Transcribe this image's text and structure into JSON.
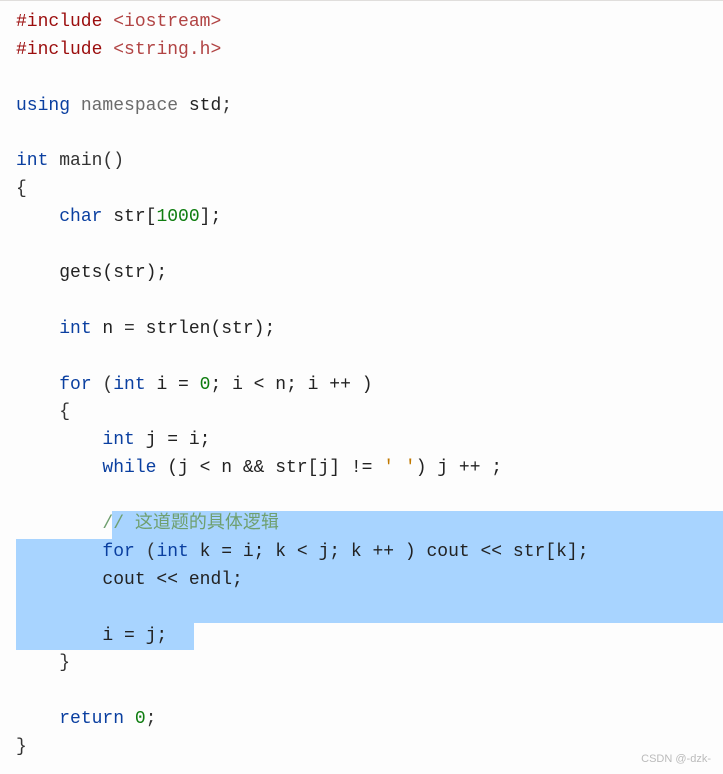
{
  "code": {
    "lines": [
      {
        "type": "include",
        "directive": "#include",
        "path": "<iostream>"
      },
      {
        "type": "include",
        "directive": "#include",
        "path": "<string.h>"
      },
      {
        "type": "blank"
      },
      {
        "type": "using",
        "kw1": "using",
        "ns": "namespace",
        "ident": "std",
        "semi": ";"
      },
      {
        "type": "blank"
      },
      {
        "type": "func-decl",
        "ret": "int",
        "name": "main",
        "parens": "()"
      },
      {
        "type": "brace-open",
        "text": "{"
      },
      {
        "type": "decl",
        "indent": 1,
        "kw": "char",
        "rest": " str[",
        "num": "1000",
        "rest2": "];"
      },
      {
        "type": "blank"
      },
      {
        "type": "call",
        "indent": 1,
        "text": "gets(str);"
      },
      {
        "type": "blank"
      },
      {
        "type": "decl2",
        "indent": 1,
        "kw": "int",
        "ident": " n ",
        "op": "=",
        "rest": " strlen(str);"
      },
      {
        "type": "blank"
      },
      {
        "type": "for1",
        "indent": 1,
        "kw": "for",
        "p1": " (",
        "kw2": "int",
        "rest": " i = ",
        "num": "0",
        "rest2": "; i < n; i ++ )"
      },
      {
        "type": "brace-open-i1",
        "indent": 1,
        "text": "{"
      },
      {
        "type": "decl3",
        "indent": 2,
        "kw": "int",
        "rest": " j = i;"
      },
      {
        "type": "while1",
        "indent": 2,
        "kw": "while",
        "rest": " (j < n && str[j] != ",
        "str": "' '",
        "rest2": ") j ++ ;"
      },
      {
        "type": "blank"
      },
      {
        "type": "comment",
        "indent": 2,
        "text": "// 这道题的具体逻辑",
        "highlighted": true
      },
      {
        "type": "for2",
        "indent": 2,
        "kw": "for",
        "p1": " (",
        "kw2": "int",
        "rest": " k = i; k < j; k ++ ) cout << str[k];",
        "highlighted": true
      },
      {
        "type": "stmt",
        "indent": 2,
        "text": "cout << endl;",
        "highlighted": true
      },
      {
        "type": "blank",
        "highlighted": true
      },
      {
        "type": "stmt",
        "indent": 2,
        "text": "i = j;",
        "highlighted": "partial"
      },
      {
        "type": "brace-close-i1",
        "indent": 1,
        "text": "}"
      },
      {
        "type": "blank"
      },
      {
        "type": "return",
        "indent": 1,
        "kw": "return",
        "sp": " ",
        "num": "0",
        "semi": ";"
      },
      {
        "type": "brace-close",
        "text": "}"
      }
    ]
  },
  "watermark": "CSDN @-dzk-"
}
